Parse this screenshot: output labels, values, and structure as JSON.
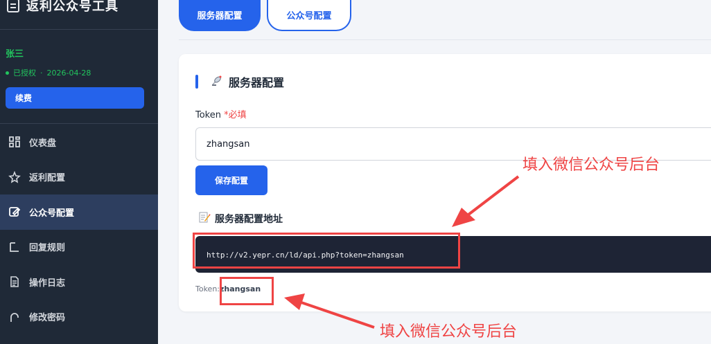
{
  "app": {
    "title": "返利公众号工具"
  },
  "user": {
    "name": "张三",
    "status": "已授权",
    "expires": "2026-04-28",
    "renew_label": "续费"
  },
  "sidebar": {
    "items": [
      {
        "label": "仪表盘",
        "icon": "dashboard-icon"
      },
      {
        "label": "返利配置",
        "icon": "star-icon"
      },
      {
        "label": "公众号配置",
        "icon": "edit-icon"
      },
      {
        "label": "回复规则",
        "icon": "reply-icon"
      },
      {
        "label": "操作日志",
        "icon": "log-icon"
      },
      {
        "label": "修改密码",
        "icon": "key-icon"
      }
    ],
    "active_index": 2
  },
  "tabs": [
    {
      "label": "服务器配置",
      "active": true
    },
    {
      "label": "公众号配置",
      "active": false
    }
  ],
  "server_config": {
    "title": "服务器配置",
    "token_label": "Token",
    "token_required": "*必填",
    "token_value": "zhangsan",
    "save_label": "保存配置",
    "url_title": "服务器配置地址",
    "url": "http://v2.yepr.cn/ld/api.php?token=zhangsan",
    "token_note_prefix": "Token:",
    "token_note_value": "zhangsan"
  },
  "annotations": {
    "top_text": "填入微信公众号后台",
    "bottom_text": "填入微信公众号后台",
    "color": "#ef4444"
  },
  "colors": {
    "accent": "#2563eb",
    "sidebar_bg": "#1f2937",
    "success": "#22c55e"
  }
}
